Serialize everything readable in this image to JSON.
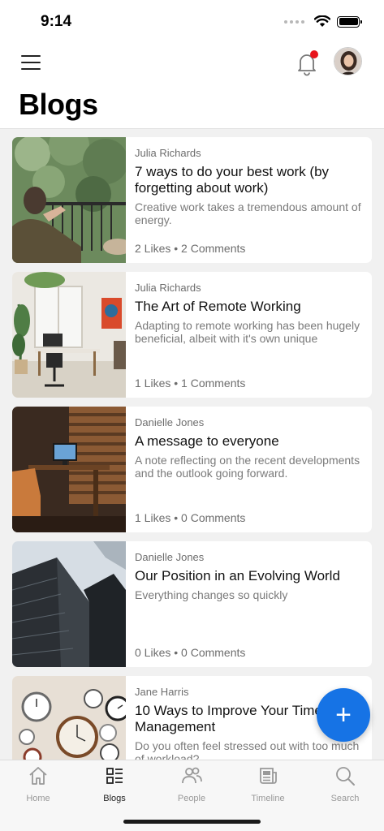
{
  "status_bar": {
    "time": "9:14"
  },
  "header": {
    "title": "Blogs",
    "notification_dot_color": "#e8141c"
  },
  "posts": [
    {
      "author": "Julia Richards",
      "title": "7 ways to do your best work (by forgetting about work)",
      "excerpt": "Creative work takes a tremendous amount of energy.",
      "stats": "2 Likes • 2 Comments"
    },
    {
      "author": "Julia Richards",
      "title": "The Art of Remote Working",
      "excerpt": "Adapting to remote working has been hugely beneficial, albeit with it's own unique difficulties.",
      "stats": "1 Likes • 1 Comments"
    },
    {
      "author": "Danielle Jones",
      "title": "A message to everyone",
      "excerpt": "A note reflecting on the recent developments and the outlook going forward.",
      "stats": "1 Likes • 0 Comments"
    },
    {
      "author": "Danielle Jones",
      "title": "Our Position in an Evolving World",
      "excerpt": "Everything changes so quickly",
      "stats": "0 Likes • 0 Comments"
    },
    {
      "author": "Jane Harris",
      "title": "10 Ways to Improve Your Time Management",
      "excerpt": "Do you often feel stressed out with too much of workload?",
      "stats": ""
    }
  ],
  "fab": {
    "label": "+",
    "color": "#1673e5"
  },
  "tabs": [
    {
      "label": "Home",
      "icon": "home-icon"
    },
    {
      "label": "Blogs",
      "icon": "blogs-icon"
    },
    {
      "label": "People",
      "icon": "people-icon"
    },
    {
      "label": "Timeline",
      "icon": "newspaper-icon"
    },
    {
      "label": "Search",
      "icon": "search-icon"
    }
  ],
  "active_tab": "Blogs"
}
